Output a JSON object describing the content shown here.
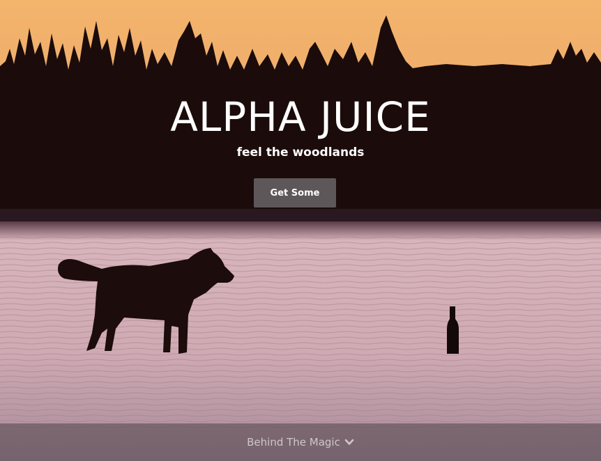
{
  "hero": {
    "title": "ALPHA JUICE",
    "tagline": "feel the woodlands",
    "cta_label": "Get Some",
    "scroll_link_label": "Behind The Magic",
    "scroll_icon": "chevron-down-icon"
  },
  "colors": {
    "sky_top": "#f0b36d",
    "sky_bottom": "#e8a36a",
    "forest": "#1b0c0b",
    "snow": "#d9b9bf",
    "text": "#ffffff",
    "button_bg": "#6e686a"
  }
}
